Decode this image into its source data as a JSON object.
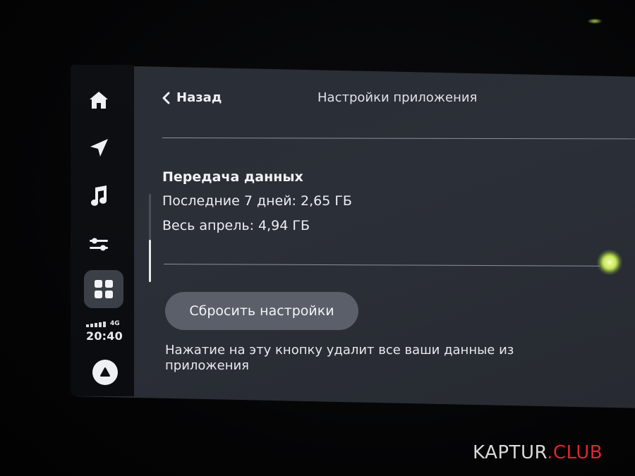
{
  "sidebar": {
    "items": [
      {
        "icon": "home-icon"
      },
      {
        "icon": "navigation-arrow-icon"
      },
      {
        "icon": "music-note-icon"
      },
      {
        "icon": "settings-sliders-icon"
      },
      {
        "icon": "apps-grid-icon",
        "active": true
      }
    ],
    "status": {
      "network": "4G",
      "time": "20:40"
    },
    "assistant_icon": "alice-assistant-icon"
  },
  "header": {
    "back_label": "Назад",
    "title": "Настройки приложения"
  },
  "data_transfer": {
    "title": "Передача данных",
    "rows": [
      "Последние 7 дней: 2,65 ГБ",
      "Весь апрель: 4,94 ГБ"
    ]
  },
  "reset": {
    "button_label": "Сбросить настройки",
    "hint": "Нажатие на эту кнопку удалит все ваши данные из приложения"
  },
  "watermark": {
    "part1": "KAPTUR",
    "part2": ".CLUB"
  },
  "colors": {
    "screen_bg": "#2b2f37",
    "sidebar_bg": "#0d0f12",
    "button_bg": "#5b5f6a",
    "text": "#eceef2",
    "watermark_accent": "#e0262b"
  }
}
